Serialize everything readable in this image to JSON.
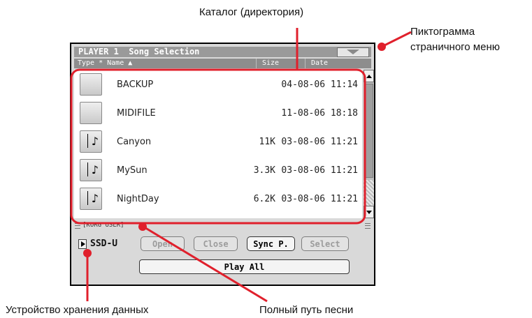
{
  "callouts": {
    "directory": "Каталог (директория)",
    "page_menu_line1": "Пиктограмма",
    "page_menu_line2": "страничного меню",
    "storage_device": "Устройство хранения данных",
    "song_path": "Полный путь песни"
  },
  "header": {
    "title": "PLAYER 1  Song Selection"
  },
  "columns": {
    "type": "Type * Name ▲",
    "size": "Size",
    "date": "Date"
  },
  "files": [
    {
      "icon": "folder-icon",
      "name": "BACKUP",
      "size": "",
      "date": "04-08-06 11:14"
    },
    {
      "icon": "folder-icon",
      "name": "MIDIFILE",
      "size": "",
      "date": "11-08-06 18:18"
    },
    {
      "icon": "song-file-icon",
      "name": "Canyon",
      "size": "11K",
      "date": "03-08-06 11:21"
    },
    {
      "icon": "song-file-icon",
      "name": "MySun",
      "size": "3.3K",
      "date": "03-08-06 11:21"
    },
    {
      "icon": "song-file-icon",
      "name": "NightDay",
      "size": "6.2K",
      "date": "03-08-06 11:21"
    }
  ],
  "path": "[KORG USER]",
  "device": "SSD-U",
  "buttons": {
    "open": "Open",
    "close": "Close",
    "sync": "Sync P.",
    "select": "Select",
    "play_all": "Play All"
  },
  "colors": {
    "highlight": "#e0202c",
    "title_bar": "#9a9a9a",
    "panel": "#d9d9d9"
  }
}
